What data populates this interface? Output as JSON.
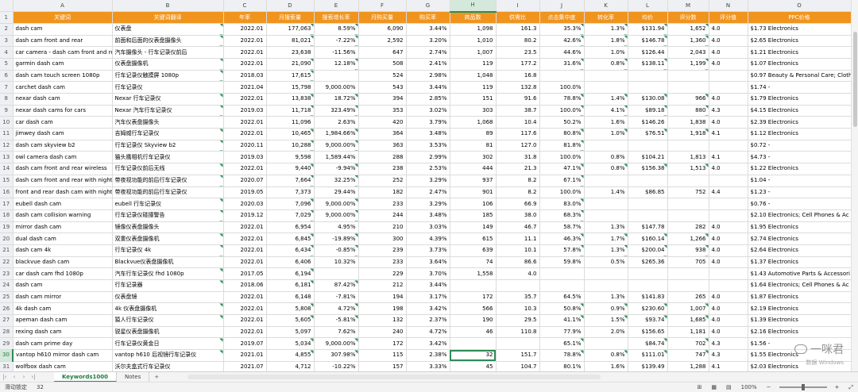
{
  "columns": [
    "A",
    "B",
    "C",
    "D",
    "E",
    "F",
    "G",
    "H",
    "I",
    "J",
    "K",
    "L",
    "M",
    "N",
    "O"
  ],
  "active_column": "H",
  "active_row": 30,
  "header_row": [
    "关键词",
    "关键词翻译",
    "年率",
    "月搜索量",
    "搜索增长率",
    "月购买量",
    "购买率",
    "商品数",
    "供需比",
    "点击集中度",
    "转化率",
    "均价",
    "评分数",
    "评分值",
    "PPC价格"
  ],
  "rows": [
    [
      "dash cam",
      "仪表盘",
      "2022.01",
      "177,063",
      "8.59%",
      "6,090",
      "3.44%",
      "1,098",
      "161.3",
      "35.3%",
      "1.3%",
      "$131.94",
      "1,652",
      "4.0",
      "$1.73 Electronics"
    ],
    [
      "dash cam front and rear",
      "前面和后面的仪表盘摄像头",
      "2022.01",
      "81,021",
      "-7.22%",
      "2,592",
      "3.20%",
      "1,010",
      "80.2",
      "42.6%",
      "1.8%",
      "$146.78",
      "1,360",
      "4.0",
      "$2.65 Electronics"
    ],
    [
      "car camera - dash cam front and rear",
      "汽车摄像头 - 行车记录仪前后",
      "2022.01",
      "23,638",
      "-11.56%",
      "647",
      "2.74%",
      "1,007",
      "23.5",
      "44.6%",
      "1.0%",
      "$126.44",
      "2,043",
      "4.0",
      "$1.21 Electronics"
    ],
    [
      "garmin dash cam",
      "仪表盘摄像机",
      "2022.01",
      "21,090",
      "12.18%",
      "508",
      "2.41%",
      "119",
      "177.2",
      "31.6%",
      "0.8%",
      "$138.11",
      "1,199",
      "4.0",
      "$1.07 Electronics"
    ],
    [
      "dash cam touch screen 1080p",
      "行车记录仪触摸屏 1080p",
      "2018.03",
      "17,615",
      "",
      "524",
      "2.98%",
      "1,048",
      "16.8",
      "",
      "",
      "",
      "",
      "",
      "$0.97 Beauty & Personal Care; Cloth"
    ],
    [
      "carchet dash cam",
      "行车记录仪",
      "2021.04",
      "15,798",
      "9,000.00%",
      "543",
      "3.44%",
      "119",
      "132.8",
      "100.0%",
      "",
      "",
      "",
      "",
      "$1.74 -"
    ],
    [
      "nexar dash cam",
      "Nexar 行车记录仪",
      "2022.01",
      "13,838",
      "18.72%",
      "394",
      "2.85%",
      "151",
      "91.6",
      "78.8%",
      "1.4%",
      "$130.08",
      "966",
      "4.0",
      "$1.79 Electronics"
    ],
    [
      "nexar dash cams for cars",
      "Nexar 汽车行车记录仪",
      "2019.03",
      "11,718",
      "323.49%",
      "353",
      "3.02%",
      "303",
      "38.7",
      "100.0%",
      "4.1%",
      "$89.18",
      "880",
      "4.3",
      "$4.15 Electronics"
    ],
    [
      "car dash cam",
      "汽车仪表盘摄像头",
      "2022.01",
      "11,096",
      "2.63%",
      "420",
      "3.79%",
      "1,068",
      "10.4",
      "50.2%",
      "1.6%",
      "$146.26",
      "1,838",
      "4.0",
      "$2.39 Electronics"
    ],
    [
      "jimwey dash cam",
      "吉姆威行车记录仪",
      "2022.01",
      "10,465",
      "1,984.66%",
      "364",
      "3.48%",
      "89",
      "117.6",
      "80.8%",
      "1.0%",
      "$76.51",
      "1,918",
      "4.1",
      "$1.12 Electronics"
    ],
    [
      "dash cam skyview b2",
      "行车记录仪 Skyview b2",
      "2020.11",
      "10,288",
      "9,000.00%",
      "363",
      "3.53%",
      "81",
      "127.0",
      "81.8%",
      "",
      "",
      "",
      "",
      "$0.72 -"
    ],
    [
      "owl camera dash cam",
      "猫头鹰相机行车记录仪",
      "2019.03",
      "9,598",
      "1,589.44%",
      "288",
      "2.99%",
      "302",
      "31.8",
      "100.0%",
      "0.8%",
      "$104.21",
      "1,813",
      "4.1",
      "$4.73 -"
    ],
    [
      "dash cam front and rear wireless",
      "行车记录仪前后无线",
      "2022.01",
      "9,440",
      "-9.94%",
      "238",
      "2.53%",
      "444",
      "21.3",
      "47.1%",
      "0.8%",
      "$156.38",
      "1,513",
      "4.0",
      "$1.22 Electronics"
    ],
    [
      "dash cam front and rear with night visi",
      "带夜视功能的前后行车记录仪",
      "2020.07",
      "7,664",
      "32.25%",
      "252",
      "3.29%",
      "937",
      "8.2",
      "67.1%",
      "",
      "",
      "",
      "",
      "$1.04 -"
    ],
    [
      "front and rear dash cam with night visic",
      "带夜视功能的前后行车记录仪",
      "2019.05",
      "7,373",
      "29.44%",
      "182",
      "2.47%",
      "901",
      "8.2",
      "100.0%",
      "1.4%",
      "$86.85",
      "752",
      "4.4",
      "$1.23 -"
    ],
    [
      "eubell dash cam",
      "eubell 行车记录仪",
      "2020.03",
      "7,096",
      "9,000.00%",
      "233",
      "3.29%",
      "106",
      "66.9",
      "83.0%",
      "",
      "",
      "",
      "",
      "$0.76 -"
    ],
    [
      "dash cam collision warning",
      "行车记录仪碰撞警告",
      "2019.12",
      "7,029",
      "9,000.00%",
      "244",
      "3.48%",
      "185",
      "38.0",
      "68.3%",
      "",
      "",
      "",
      "",
      "$2.10 Electronics; Cell Phones & Ac"
    ],
    [
      "mirror dash cam",
      "镜像仪表盘摄像头",
      "2022.01",
      "6,954",
      "4.95%",
      "210",
      "3.03%",
      "149",
      "46.7",
      "58.7%",
      "1.3%",
      "$147.78",
      "282",
      "4.0",
      "$1.95 Electronics"
    ],
    [
      "dual dash cam",
      "双重仪表盘摄像机",
      "2022.01",
      "6,845",
      "-19.89%",
      "300",
      "4.39%",
      "615",
      "11.1",
      "46.3%",
      "1.7%",
      "$160.14",
      "1,266",
      "4.0",
      "$2.74 Electronics"
    ],
    [
      "dash cam 4k",
      "行车记录仪 4k",
      "2022.01",
      "6,434",
      "-0.85%",
      "239",
      "3.73%",
      "639",
      "10.1",
      "57.8%",
      "1.3%",
      "$200.04",
      "938",
      "4.0",
      "$2.64 Electronics"
    ],
    [
      "blackvue dash cam",
      "Blackvue仪表盘摄像机",
      "2022.01",
      "6,406",
      "10.32%",
      "233",
      "3.64%",
      "74",
      "86.6",
      "59.8%",
      "0.5%",
      "$265.36",
      "705",
      "4.0",
      "$1.37 Electronics"
    ],
    [
      "car dash cam fhd 1080p",
      "汽车行车记录仪 fhd 1080p",
      "2017.05",
      "6,194",
      "",
      "229",
      "3.70%",
      "1,558",
      "4.0",
      "",
      "",
      "",
      "",
      "",
      "$1.43 Automotive Parts & Accessori"
    ],
    [
      "dash cam",
      "行车记录器",
      "2018.06",
      "6,181",
      "87.42%",
      "212",
      "3.44%",
      "",
      "",
      "",
      "",
      "",
      "",
      "",
      "$1.64 Electronics; Cell Phones & Ac"
    ],
    [
      "dash cam mirror",
      "仪表盘镜",
      "2022.01",
      "6,148",
      "-7.81%",
      "194",
      "3.17%",
      "172",
      "35.7",
      "64.5%",
      "1.3%",
      "$141.83",
      "265",
      "4.0",
      "$1.87 Electronics"
    ],
    [
      "4k dash cam",
      "4k 仪表盘摄像机",
      "2022.01",
      "5,808",
      "4.72%",
      "198",
      "3.42%",
      "566",
      "10.3",
      "50.8%",
      "0.9%",
      "$230.60",
      "1,007",
      "4.0",
      "$2.19 Electronics"
    ],
    [
      "apeman dash cam",
      "猿人行车记录仪",
      "2022.01",
      "5,605",
      "-5.81%",
      "132",
      "2.37%",
      "190",
      "29.5",
      "41.1%",
      "1.5%",
      "$93.74",
      "1,685",
      "4.0",
      "$1.39 Electronics"
    ],
    [
      "rexing dash cam",
      "锐星仪表盘摄像机",
      "2022.01",
      "5,097",
      "7.62%",
      "240",
      "4.72%",
      "46",
      "110.8",
      "77.9%",
      "2.0%",
      "$156.65",
      "1,181",
      "4.0",
      "$2.16 Electronics"
    ],
    [
      "dash cam prime day",
      "行车记录仪黄金日",
      "2019.07",
      "5,034",
      "9,000.00%",
      "172",
      "3.42%",
      "",
      "",
      "65.1%",
      "",
      "$84.74",
      "702",
      "4.3",
      "$1.56 -"
    ],
    [
      "vantop h610 mirror dash cam",
      "vantop h610 后视镜行车记录仪",
      "2021.01",
      "4,855",
      "307.98%",
      "115",
      "2.38%",
      "32",
      "151.7",
      "78.8%",
      "0.8%",
      "$111.01",
      "747",
      "4.3",
      "$1.55 Electronics"
    ],
    [
      "wolfbox dash cam",
      "沃尔夫盒式行车记录仪",
      "2021.07",
      "4,712",
      "-10.22%",
      "157",
      "3.33%",
      "45",
      "104.7",
      "80.1%",
      "1.6%",
      "$139.49",
      "1,288",
      "4.1",
      "$2.03 Electronics"
    ]
  ],
  "tabs": [
    "Keywords1000",
    "Notes"
  ],
  "active_tab": "Keywords1000",
  "status": {
    "mode": "滑动锁定",
    "value": "32",
    "zoom": "100%"
  },
  "watermark": {
    "text": "一咪君",
    "sub": "数据 Windows"
  }
}
